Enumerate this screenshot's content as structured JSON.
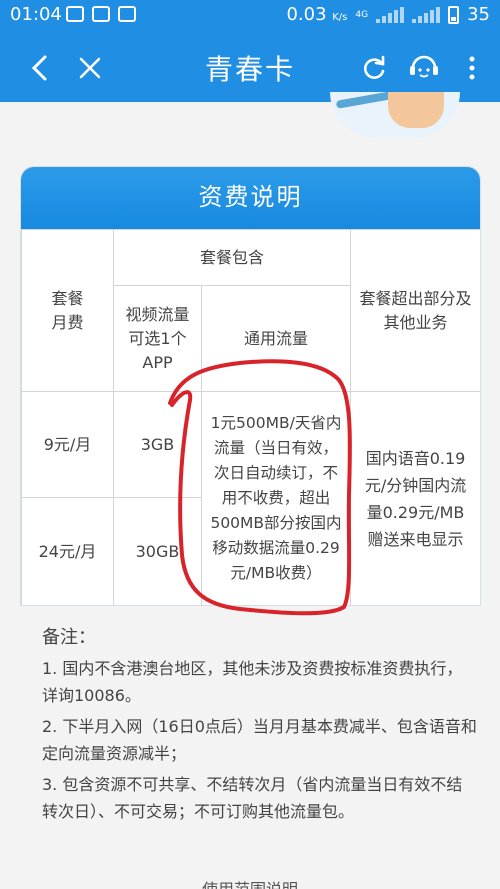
{
  "status_bar": {
    "time": "01:04",
    "speed": "0.03",
    "speed_unit": "K/s",
    "network": "4G",
    "battery": "35"
  },
  "app_bar": {
    "title": "青春卡"
  },
  "card": {
    "title": "资费说明",
    "headers": {
      "monthly_fee": "套餐月费",
      "package_includes": "套餐包含",
      "video_traffic": "视频流量可选1个APP",
      "general_traffic": "通用流量",
      "overage": "套餐超出部分及其他业务"
    },
    "rows": [
      {
        "fee": "9元/月",
        "video": "3GB"
      },
      {
        "fee": "24元/月",
        "video": "30GB"
      }
    ],
    "general_traffic_value": "1元500MB/天省内流量（当日有效，次日自动续订，不用不收费，超出500MB部分按国内移动数据流量0.29元/MB收费）",
    "overage_value": "国内语音0.19元/分钟国内流量0.29元/MB赠送来电显示"
  },
  "notes": {
    "title": "备注：",
    "items": [
      "1. 国内不含港澳台地区，其他未涉及资费按标准资费执行，详询10086。",
      "2. 下半月入网（16日0点后）当月月基本费减半、包含语音和定向流量资源减半；",
      "3. 包含资源不可共享、不结转次月（省内流量当日有效不结转次日）、不可交易；不可订购其他流量包。"
    ]
  },
  "footer_peek": "使用范围说明",
  "colors": {
    "brand_blue": "#1f8ee3",
    "annotation_red": "#d8232a"
  },
  "icons": [
    "back-icon",
    "close-icon",
    "refresh-icon",
    "customer-service-icon",
    "more-vertical-icon"
  ]
}
